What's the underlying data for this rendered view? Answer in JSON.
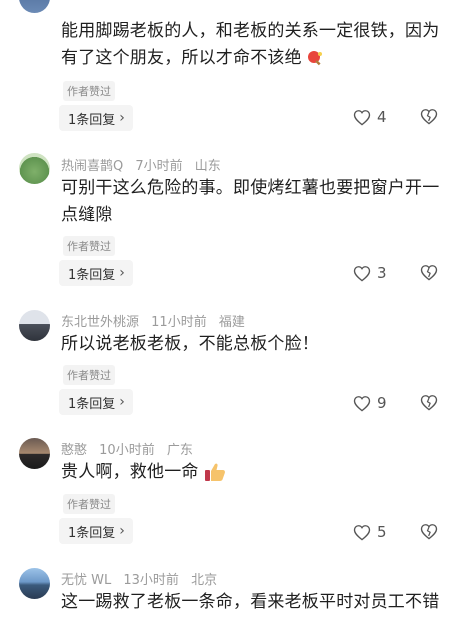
{
  "comments": [
    {
      "author": "",
      "time": "",
      "location": "",
      "text": "能用脚踢老板的人，和老板的关系一定很铁，因为有了这个朋友，所以才命不该绝",
      "badge": "作者赞过",
      "reply_label": "1条回复",
      "likes": "4"
    },
    {
      "author": "热闹喜鹊Q",
      "time": "7小时前",
      "location": "山东",
      "text": "可别干这么危险的事。即使烤红薯也要把窗户开一点缝隙",
      "badge": "作者赞过",
      "reply_label": "1条回复",
      "likes": "3"
    },
    {
      "author": "东北世外桃源",
      "time": "11小时前",
      "location": "福建",
      "text": "所以说老板老板，不能总板个脸！",
      "badge": "作者赞过",
      "reply_label": "1条回复",
      "likes": "9"
    },
    {
      "author": "憨憨",
      "time": "10小时前",
      "location": "广东",
      "text": "贵人啊，救他一命",
      "badge": "作者赞过",
      "reply_label": "1条回复",
      "likes": "5"
    },
    {
      "author": "无忧 WL",
      "time": "13小时前",
      "location": "北京",
      "text": "这一踢救了老板一条命，看来老板平时对员工不错",
      "badge": "",
      "reply_label": "",
      "likes": ""
    }
  ],
  "icons": {
    "like": "heart-outline-icon",
    "dislike": "broken-heart-icon",
    "reply_chevron": "chevron-right-icon"
  },
  "colors": {
    "meta_text": "#9b9b9b",
    "body_text": "#1f1f1f",
    "pill_bg": "#f4f4f4"
  }
}
